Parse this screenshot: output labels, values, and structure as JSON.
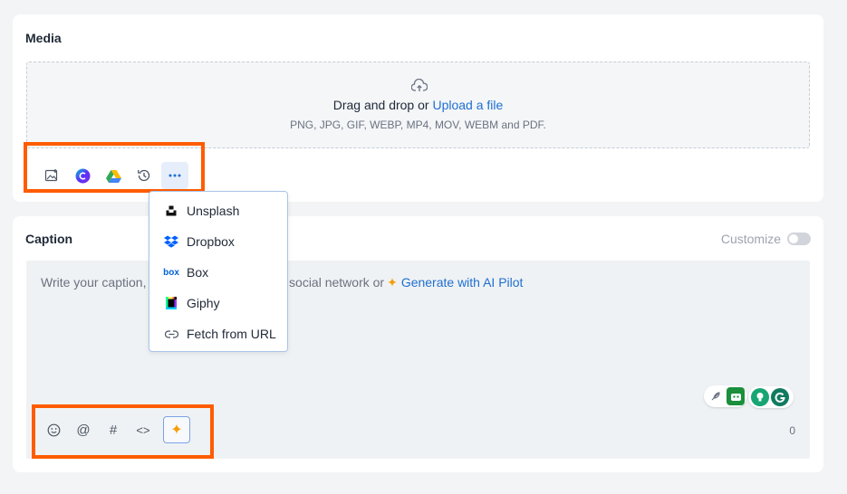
{
  "media": {
    "title": "Media",
    "dropzone": {
      "prefix": "Drag and drop or ",
      "link": "Upload a file",
      "formats": "PNG, JPG, GIF, WEBP, MP4, MOV, WEBM and PDF."
    },
    "toolbar": [
      "image-library-icon",
      "canva-icon",
      "google-drive-icon",
      "history-icon",
      "more-icon"
    ]
  },
  "more_menu": {
    "items": [
      {
        "label": "Unsplash",
        "icon": "unsplash-icon"
      },
      {
        "label": "Dropbox",
        "icon": "dropbox-icon"
      },
      {
        "label": "Box",
        "icon": "box-icon"
      },
      {
        "label": "Giphy",
        "icon": "giphy-icon"
      },
      {
        "label": "Fetch from URL",
        "icon": "link-icon"
      }
    ]
  },
  "caption": {
    "title": "Caption",
    "customize_label": "Customize",
    "placeholder_start": "Write your caption,",
    "placeholder_end": "th social network or",
    "ai_link": "Generate with AI Pilot",
    "char_count": "0",
    "toolbar": {
      "emoji": "☺",
      "mention": "@",
      "hashtag": "#",
      "code": "<>",
      "ai": "✦"
    }
  },
  "colors": {
    "accent": "#1f6fd1",
    "highlight": "#ff5c00",
    "ai_sparkle": "#f59e0b"
  }
}
